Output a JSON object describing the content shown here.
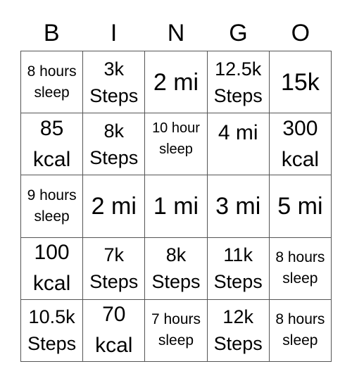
{
  "header": [
    "B",
    "I",
    "N",
    "G",
    "O"
  ],
  "cells": [
    {
      "text": "8 hours\nsleep",
      "size": "s-s"
    },
    {
      "text": "3k\nSteps",
      "size": "s-m"
    },
    {
      "text": "2 mi",
      "size": "s-xl"
    },
    {
      "text": "12.5k\nSteps",
      "size": "s-m"
    },
    {
      "text": "15k",
      "size": "s-xl"
    },
    {
      "text": "85\nkcal",
      "size": "s-l"
    },
    {
      "text": "8k\nSteps",
      "size": "s-m"
    },
    {
      "text": "10 hour\nsleep",
      "size": "s-xs",
      "align": "top"
    },
    {
      "text": "4 mi",
      "size": "s-l",
      "align": "top"
    },
    {
      "text": "300\nkcal",
      "size": "s-l"
    },
    {
      "text": "9 hours\nsleep",
      "size": "s-s"
    },
    {
      "text": "2 mi",
      "size": "s-xl"
    },
    {
      "text": "1 mi",
      "size": "s-xl"
    },
    {
      "text": "3 mi",
      "size": "s-xl"
    },
    {
      "text": "5 mi",
      "size": "s-xl"
    },
    {
      "text": "100\nkcal",
      "size": "s-l"
    },
    {
      "text": "7k\nSteps",
      "size": "s-m"
    },
    {
      "text": "8k\nSteps",
      "size": "s-m"
    },
    {
      "text": "11k\nSteps",
      "size": "s-m"
    },
    {
      "text": "8 hours\nsleep",
      "size": "s-s"
    },
    {
      "text": "10.5k\nSteps",
      "size": "s-m"
    },
    {
      "text": "70\nkcal",
      "size": "s-l"
    },
    {
      "text": "7 hours\nsleep",
      "size": "s-s"
    },
    {
      "text": "12k\nSteps",
      "size": "s-m"
    },
    {
      "text": "8 hours\nsleep",
      "size": "s-s"
    }
  ]
}
